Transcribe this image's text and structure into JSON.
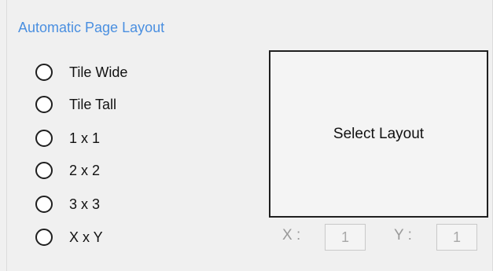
{
  "group": {
    "title": "Automatic Page Layout"
  },
  "options": [
    {
      "label": "Tile Wide",
      "selected": false
    },
    {
      "label": "Tile Tall",
      "selected": false
    },
    {
      "label": "1 x 1",
      "selected": false
    },
    {
      "label": "2 x 2",
      "selected": false
    },
    {
      "label": "3 x 3",
      "selected": false
    },
    {
      "label": "X x Y",
      "selected": false
    }
  ],
  "preview": {
    "text": "Select Layout"
  },
  "dimensions": {
    "x_label": "X :",
    "x_value": "1",
    "y_label": "Y :",
    "y_value": "1"
  },
  "colors": {
    "accent": "#4a8fe0",
    "disabled_text": "#9a9a9a"
  }
}
